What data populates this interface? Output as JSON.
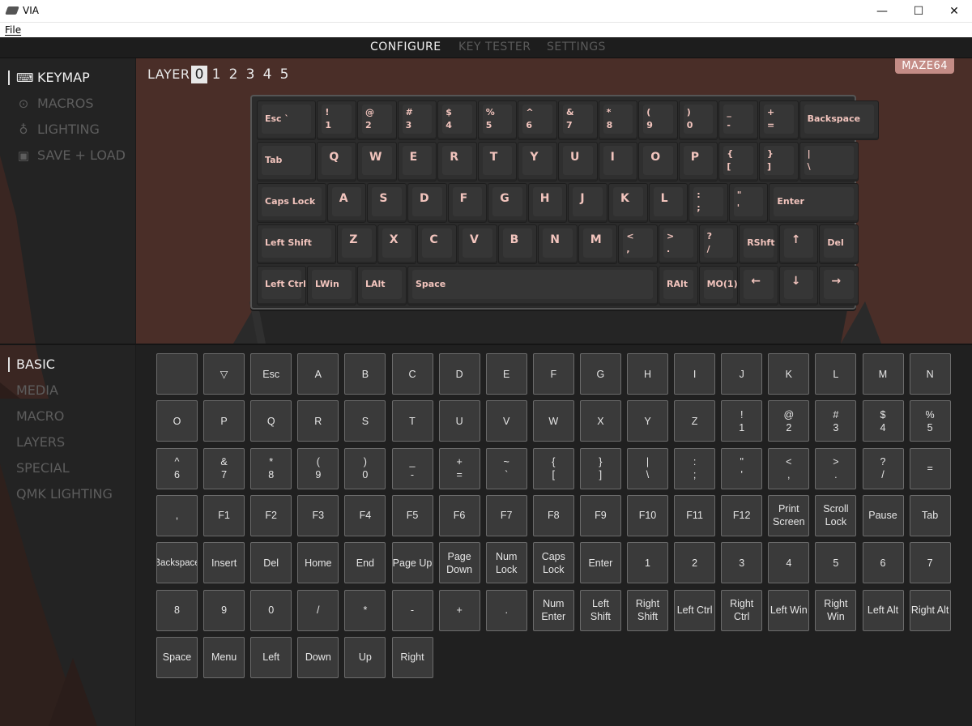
{
  "window": {
    "title": "VIA",
    "minimize": "—",
    "maximize": "☐",
    "close": "✕"
  },
  "menubar": {
    "file": "File"
  },
  "topnav": {
    "tabs": [
      {
        "label": "CONFIGURE"
      },
      {
        "label": "KEY TESTER"
      },
      {
        "label": "SETTINGS"
      }
    ]
  },
  "sidebar_top": {
    "items": [
      {
        "label": "KEYMAP",
        "icon": "keyboard-icon"
      },
      {
        "label": "MACROS",
        "icon": "circle-dot-icon"
      },
      {
        "label": "LIGHTING",
        "icon": "lightbulb-icon"
      },
      {
        "label": "SAVE + LOAD",
        "icon": "floppy-icon"
      }
    ]
  },
  "sidebar_bottom": {
    "items": [
      {
        "label": "BASIC"
      },
      {
        "label": "MEDIA"
      },
      {
        "label": "MACRO"
      },
      {
        "label": "LAYERS"
      },
      {
        "label": "SPECIAL"
      },
      {
        "label": "QMK LIGHTING"
      }
    ]
  },
  "keymap": {
    "layer_label": "LAYER",
    "layers": [
      "0",
      "1",
      "2",
      "3",
      "4",
      "5"
    ],
    "active_layer": "0",
    "keyboard_name": "MAZE64",
    "rows": [
      [
        [
          "Esc `",
          1.5
        ],
        [
          "!|1",
          1
        ],
        [
          "@|2",
          1
        ],
        [
          "#|3",
          1
        ],
        [
          "$|4",
          1
        ],
        [
          "%|5",
          1
        ],
        [
          "^|6",
          1
        ],
        [
          "&|7",
          1
        ],
        [
          "*|8",
          1
        ],
        [
          "(|9",
          1
        ],
        [
          ")|0",
          1
        ],
        [
          "_|-",
          1
        ],
        [
          "+|=",
          1
        ],
        [
          "Backspace",
          2
        ]
      ],
      [
        [
          "Tab",
          1.5
        ],
        [
          "Q",
          1
        ],
        [
          "W",
          1
        ],
        [
          "E",
          1
        ],
        [
          "R",
          1
        ],
        [
          "T",
          1
        ],
        [
          "Y",
          1
        ],
        [
          "U",
          1
        ],
        [
          "I",
          1
        ],
        [
          "O",
          1
        ],
        [
          "P",
          1
        ],
        [
          "{|[",
          1
        ],
        [
          "}|]",
          1
        ],
        [
          "||\\",
          1.5
        ]
      ],
      [
        [
          "Caps Lock",
          1.75
        ],
        [
          "A",
          1
        ],
        [
          "S",
          1
        ],
        [
          "D",
          1
        ],
        [
          "F",
          1
        ],
        [
          "G",
          1
        ],
        [
          "H",
          1
        ],
        [
          "J",
          1
        ],
        [
          "K",
          1
        ],
        [
          "L",
          1
        ],
        [
          ":|;",
          1
        ],
        [
          "\"|'",
          1
        ],
        [
          "Enter",
          2.25
        ]
      ],
      [
        [
          "Left Shift",
          2
        ],
        [
          "Z",
          1
        ],
        [
          "X",
          1
        ],
        [
          "C",
          1
        ],
        [
          "V",
          1
        ],
        [
          "B",
          1
        ],
        [
          "N",
          1
        ],
        [
          "M",
          1
        ],
        [
          "<|,",
          1
        ],
        [
          ">|.",
          1
        ],
        [
          "?|/",
          1
        ],
        [
          "RShft",
          1
        ],
        [
          "↑",
          1
        ],
        [
          "Del",
          1
        ]
      ],
      [
        [
          "Left Ctrl",
          1.25
        ],
        [
          "LWin",
          1.25
        ],
        [
          "LAlt",
          1.25
        ],
        [
          "Space",
          6.25
        ],
        [
          "RAlt",
          1
        ],
        [
          "MO(1)",
          1
        ],
        [
          "←",
          1
        ],
        [
          "↓",
          1
        ],
        [
          "→",
          1
        ]
      ]
    ]
  },
  "picker": {
    "keys": [
      "",
      "▽",
      "Esc",
      "A",
      "B",
      "C",
      "D",
      "E",
      "F",
      "G",
      "H",
      "I",
      "J",
      "K",
      "L",
      "M",
      "N",
      "O",
      "P",
      "Q",
      "R",
      "S",
      "T",
      "U",
      "V",
      "W",
      "X",
      "Y",
      "Z",
      "!\n1",
      "@\n2",
      "#\n3",
      "$\n4",
      "%\n5",
      "^\n6",
      "&\n7",
      "*\n8",
      "(\n9",
      ")\n0",
      "_\n-",
      "+\n=",
      "~\n`",
      "{\n[",
      "}\n]",
      "|\n\\",
      ":\n;",
      "\"\n'",
      "<\n,",
      ">\n.",
      "?\n/",
      "=",
      ",",
      "F1",
      "F2",
      "F3",
      "F4",
      "F5",
      "F6",
      "F7",
      "F8",
      "F9",
      "F10",
      "F11",
      "F12",
      "Print\nScreen",
      "Scroll\nLock",
      "Pause",
      "Tab",
      "Backspace",
      "Insert",
      "Del",
      "Home",
      "End",
      "Page Up",
      "Page\nDown",
      "Num\nLock",
      "Caps\nLock",
      "Enter",
      "1",
      "2",
      "3",
      "4",
      "5",
      "6",
      "7",
      "8",
      "9",
      "0",
      "/",
      "*",
      "-",
      "+",
      ".",
      "Num\nEnter",
      "Left\nShift",
      "Right\nShift",
      "Left Ctrl",
      "Right\nCtrl",
      "Left Win",
      "Right\nWin",
      "Left Alt",
      "Right Alt",
      "Space",
      "Menu",
      "Left",
      "Down",
      "Up",
      "Right"
    ]
  },
  "colors": {
    "accent_bg": "#4a2e28",
    "key_legend": "#f2c4bd",
    "badge": "#c48c86"
  }
}
